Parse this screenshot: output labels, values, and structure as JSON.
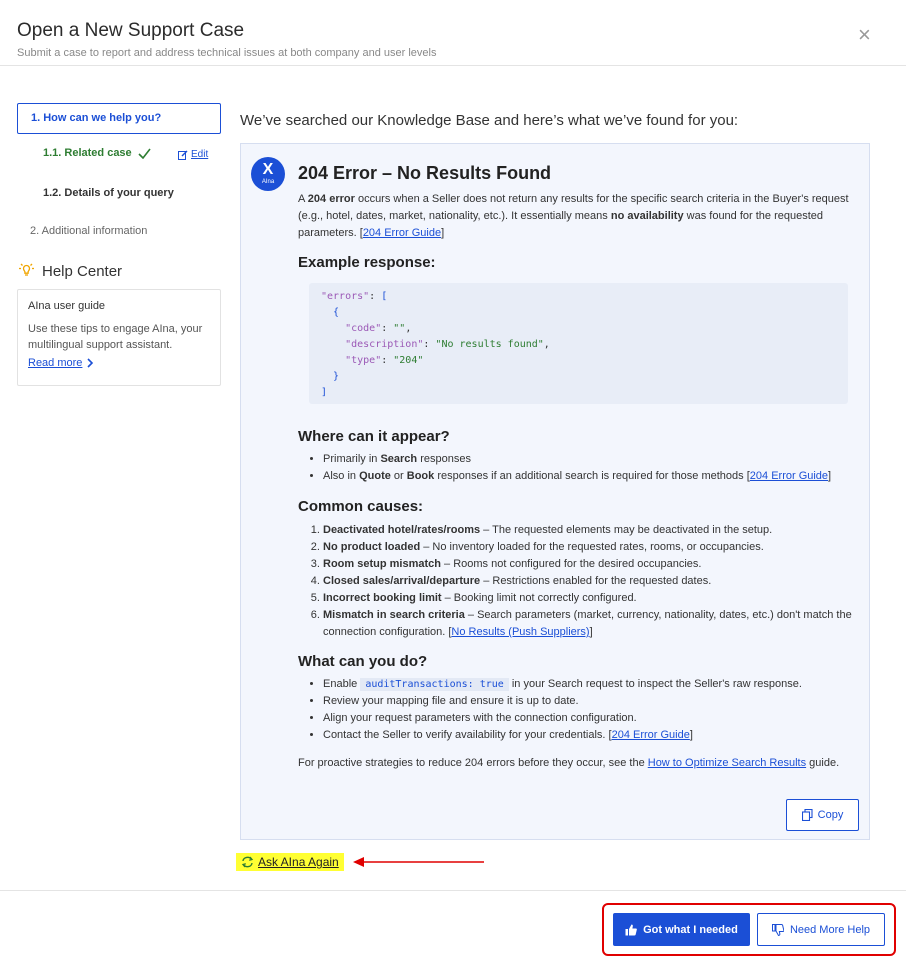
{
  "header": {
    "title": "Open a New Support Case",
    "subtitle": "Submit a case to report and address technical issues at both company and user levels",
    "close_icon": "×"
  },
  "steps": {
    "step1": "1. How can we help you?",
    "step11": "1.1. Related case",
    "edit": "Edit",
    "step12": "1.2. Details of your query",
    "step2": "2. Additional information"
  },
  "help_center": {
    "title": "Help Center",
    "guide_title": "AIna user guide",
    "guide_desc": "Use these tips to engage AIna, your multilingual support assistant.",
    "read_more": "Read more"
  },
  "kb_heading": "We’ve searched our Knowledge Base and here’s what we’ve found for you:",
  "answer": {
    "badge_x": "X",
    "badge_name": "AIna",
    "title": "204 Error – No Results Found",
    "intro": {
      "p1": "A ",
      "b1": "204 error",
      "p2": " occurs when a Seller does not return any results for the specific search criteria in the Buyer's request (e.g., hotel, dates, market, nationality, etc.). It essentially means ",
      "b2": "no availability",
      "p3": " was found for the requested parameters. [",
      "link": "204 Error Guide",
      "p4": "]"
    },
    "example_heading": "Example response:",
    "code": {
      "errors_key": "\"errors\"",
      "code_key": "\"code\"",
      "code_val": "\"\"",
      "desc_key": "\"description\"",
      "desc_val": "\"No results found\"",
      "type_key": "\"type\"",
      "type_val": "\"204\""
    },
    "where_heading": "Where can it appear?",
    "where": {
      "i1_a": "Primarily in ",
      "i1_b": "Search",
      "i1_c": " responses",
      "i2_a": "Also in ",
      "i2_b": "Quote",
      "i2_c": " or ",
      "i2_d": "Book",
      "i2_e": " responses if an additional search is required for those methods [",
      "i2_link": "204 Error Guide",
      "i2_f": "]"
    },
    "causes_heading": "Common causes:",
    "causes": [
      {
        "b": "Deactivated hotel/rates/rooms",
        "t": " – The requested elements may be deactivated in the setup."
      },
      {
        "b": "No product loaded",
        "t": " – No inventory loaded for the requested rates, rooms, or occupancies."
      },
      {
        "b": "Room setup mismatch",
        "t": " – Rooms not configured for the desired occupancies."
      },
      {
        "b": "Closed sales/arrival/departure",
        "t": " – Restrictions enabled for the requested dates."
      },
      {
        "b": "Incorrect booking limit",
        "t": " – Booking limit not correctly configured."
      },
      {
        "b": "Mismatch in search criteria",
        "t": " – Search parameters (market, currency, nationality, dates, etc.) don't match the connection configuration. [",
        "link": "No Results (Push Suppliers)",
        "end": "]"
      }
    ],
    "do_heading": "What can you do?",
    "do": {
      "i1_a": "Enable ",
      "i1_code": "auditTransactions: true",
      "i1_b": " in your Search request to inspect the Seller's raw response.",
      "i2": "Review your mapping file and ensure it is up to date.",
      "i3": "Align your request parameters with the connection configuration.",
      "i4_a": "Contact the Seller to verify availability for your credentials. [",
      "i4_link": "204 Error Guide",
      "i4_b": "]"
    },
    "footer": {
      "a": "For proactive strategies to reduce 204 errors before they occur, see the ",
      "link": "How to Optimize Search Results",
      "b": " guide."
    },
    "copy": "Copy"
  },
  "ask_again": "Ask AIna Again",
  "buttons": {
    "got": "Got what I needed",
    "more": "Need More Help"
  },
  "colors": {
    "accent": "#1b4fd6",
    "success": "#2e7d32",
    "highlight": "#ffff33",
    "annotation": "#e00000"
  }
}
